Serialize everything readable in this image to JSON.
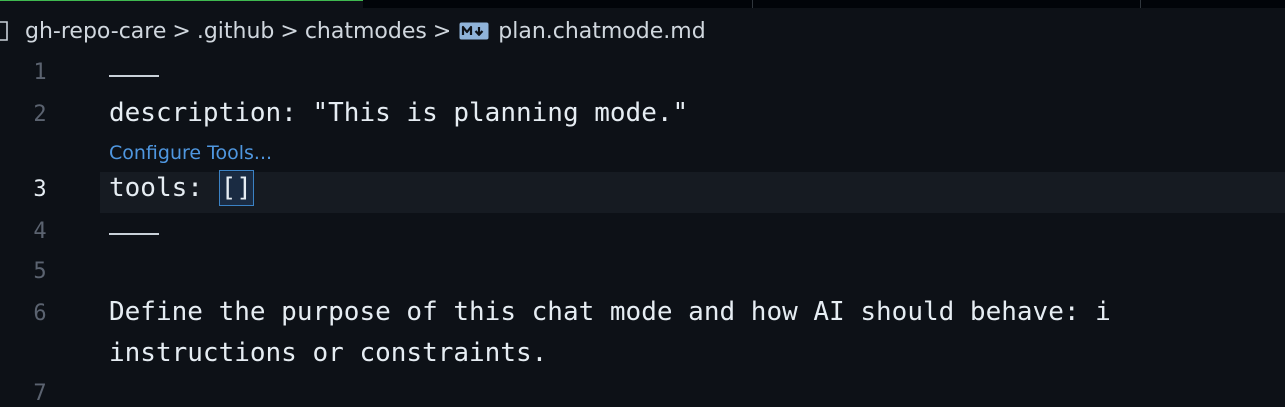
{
  "breadcrumb": {
    "items": [
      "gh-repo-care",
      ".github",
      "chatmodes"
    ],
    "separator": ">",
    "file_icon": "markdown-icon",
    "file_name": "plan.chatmode.md"
  },
  "editor": {
    "line_numbers": [
      "1",
      "2",
      "3",
      "4",
      "5",
      "6",
      "7"
    ],
    "lines": {
      "description": "description: \"This is planning mode.\"",
      "codelens": "Configure Tools...",
      "tools_key": "tools: ",
      "tools_value": "[]",
      "body_line1": "Define the purpose of this chat mode and how AI should behave: i",
      "body_line2": "instructions or constraints."
    }
  },
  "colors": {
    "background": "#0d1117",
    "codelens": "#4f97e0",
    "active_tab_border": "#3fb950"
  }
}
